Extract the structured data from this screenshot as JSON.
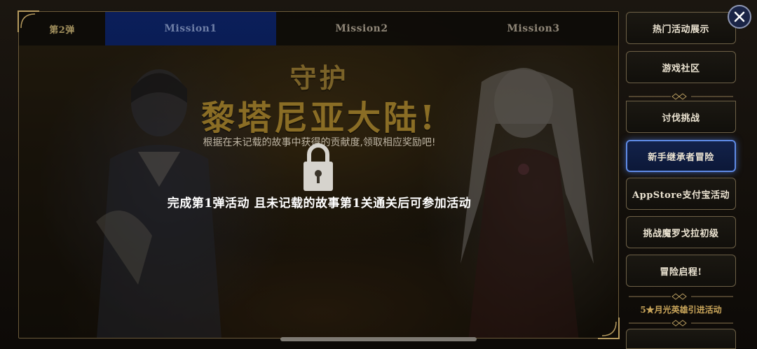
{
  "tabs": {
    "series": "第2弹",
    "mission1": "Mission1",
    "mission2": "Mission2",
    "mission3": "Mission3"
  },
  "banner": {
    "title_line1": "守护",
    "title_line2": "黎塔尼亚大陆!",
    "subtitle": "根据在未记载的故事中获得的贡献度,领取相应奖励吧!"
  },
  "lock": {
    "icon": "padlock-icon",
    "message": "完成第1弹活动 且未记载的故事第1关通关后可参加活动"
  },
  "sidebar": {
    "items": [
      {
        "label": "热门活动展示"
      },
      {
        "label": "游戏社区"
      },
      {
        "label": "讨伐挑战"
      },
      {
        "label": "新手继承者冒险",
        "active": true
      },
      {
        "label": "AppStore支付宝活动"
      },
      {
        "label": "挑战魔罗戈拉初级"
      },
      {
        "label": "冒险启程!"
      }
    ],
    "section_label": "5★月光英雄引进活动"
  },
  "close_icon": "close-icon",
  "colors": {
    "active_tab": "#0a1d55",
    "active_border": "#5f8be6",
    "gold_title": "#8a6d25",
    "section_gold": "#c9a55a"
  }
}
